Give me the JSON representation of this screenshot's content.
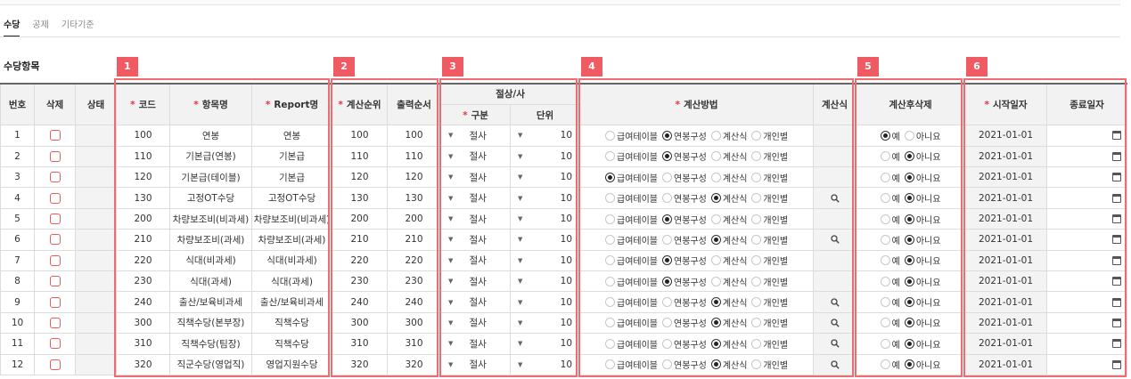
{
  "tabs": [
    "수당",
    "공제",
    "기타기준"
  ],
  "section_title": "수당항목",
  "badges": [
    "1",
    "2",
    "3",
    "4",
    "5",
    "6"
  ],
  "headers": {
    "no": "번호",
    "delete": "삭제",
    "status": "상태",
    "code": "코드",
    "name": "항목명",
    "report": "Report명",
    "calc_order": "계산순위",
    "print_order": "출력순서",
    "rounding": "절상/사",
    "rounding_type": "구분",
    "rounding_unit": "단위",
    "calc_method": "계산방법",
    "formula": "계산식",
    "delete_after": "계산후삭제",
    "start_date": "시작일자",
    "end_date": "종료일자"
  },
  "method_options": [
    "급여테이블",
    "연봉구성",
    "계산식",
    "개인별"
  ],
  "delete_options": [
    "예",
    "아니요"
  ],
  "rows": [
    {
      "no": "1",
      "code": "100",
      "name": "연봉",
      "report": "연봉",
      "calc": "100",
      "print": "100",
      "type": "절사",
      "unit": "10",
      "method": 1,
      "formula": false,
      "del": 0,
      "start": "2021-01-01"
    },
    {
      "no": "2",
      "code": "110",
      "name": "기본급(연봉)",
      "report": "기본급",
      "calc": "110",
      "print": "110",
      "type": "절사",
      "unit": "10",
      "method": 1,
      "formula": false,
      "del": 1,
      "start": "2021-01-01"
    },
    {
      "no": "3",
      "code": "120",
      "name": "기본급(테이블)",
      "report": "기본급",
      "calc": "120",
      "print": "120",
      "type": "절사",
      "unit": "10",
      "method": 0,
      "formula": false,
      "del": 1,
      "start": "2021-01-01"
    },
    {
      "no": "4",
      "code": "130",
      "name": "고정OT수당",
      "report": "고정OT수당",
      "calc": "130",
      "print": "130",
      "type": "절사",
      "unit": "10",
      "method": 2,
      "formula": true,
      "del": 1,
      "start": "2021-01-01"
    },
    {
      "no": "5",
      "code": "200",
      "name": "차량보조비(비과세)",
      "report": "차량보조비(비과세)",
      "calc": "200",
      "print": "200",
      "type": "절사",
      "unit": "10",
      "method": 1,
      "formula": false,
      "del": 1,
      "start": "2021-01-01"
    },
    {
      "no": "6",
      "code": "210",
      "name": "차량보조비(과세)",
      "report": "차량보조비(과세)",
      "calc": "210",
      "print": "210",
      "type": "절사",
      "unit": "10",
      "method": 2,
      "formula": true,
      "del": 1,
      "start": "2021-01-01"
    },
    {
      "no": "7",
      "code": "220",
      "name": "식대(비과세)",
      "report": "식대(비과세)",
      "calc": "220",
      "print": "220",
      "type": "절사",
      "unit": "10",
      "method": 1,
      "formula": false,
      "del": 1,
      "start": "2021-01-01"
    },
    {
      "no": "8",
      "code": "230",
      "name": "식대(과세)",
      "report": "식대(과세)",
      "calc": "230",
      "print": "230",
      "type": "절사",
      "unit": "10",
      "method": 1,
      "formula": false,
      "del": 1,
      "start": "2021-01-01"
    },
    {
      "no": "9",
      "code": "240",
      "name": "출산/보육비과세",
      "report": "출산/보육비과세",
      "calc": "240",
      "print": "240",
      "type": "절사",
      "unit": "10",
      "method": 2,
      "formula": true,
      "del": 1,
      "start": "2021-01-01"
    },
    {
      "no": "10",
      "code": "300",
      "name": "직책수당(본부장)",
      "report": "직책수당",
      "calc": "300",
      "print": "300",
      "type": "절사",
      "unit": "10",
      "method": 2,
      "formula": true,
      "del": 1,
      "start": "2021-01-01"
    },
    {
      "no": "11",
      "code": "310",
      "name": "직책수당(팀장)",
      "report": "직책수당",
      "calc": "310",
      "print": "310",
      "type": "절사",
      "unit": "10",
      "method": 2,
      "formula": true,
      "del": 1,
      "start": "2021-01-01"
    },
    {
      "no": "12",
      "code": "320",
      "name": "직군수당(영업직)",
      "report": "영업지원수당",
      "calc": "320",
      "print": "320",
      "type": "절사",
      "unit": "10",
      "method": 2,
      "formula": true,
      "del": 1,
      "start": "2021-01-01"
    }
  ],
  "colors": {
    "accent": "#f05a62",
    "highlight_box": "#ef6b72"
  },
  "icons": {
    "formula": "search-icon",
    "end_date": "calendar-icon",
    "delete": "checkbox-icon",
    "dropdown": "caret-down-icon"
  }
}
